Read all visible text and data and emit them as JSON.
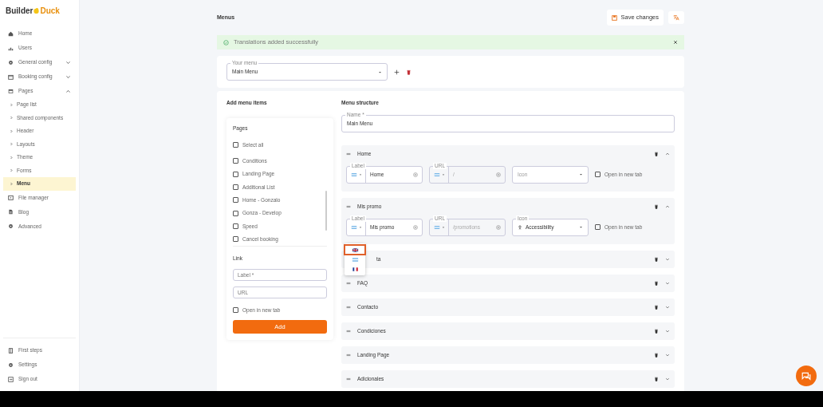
{
  "sidebar": {
    "logo": {
      "first": "Builder",
      "second": "Duck"
    },
    "items": [
      {
        "label": "Home"
      },
      {
        "label": "Users"
      },
      {
        "label": "General config",
        "expanded": false
      },
      {
        "label": "Booking config",
        "expanded": false
      },
      {
        "label": "Pages",
        "expanded": true,
        "children": [
          {
            "label": "Page list",
            "selected": false
          },
          {
            "label": "Shared components",
            "selected": false
          },
          {
            "label": "Header",
            "selected": false
          },
          {
            "label": "Layouts",
            "selected": false
          },
          {
            "label": "Theme",
            "selected": false
          },
          {
            "label": "Forms",
            "selected": false
          },
          {
            "label": "Menu",
            "selected": true
          }
        ]
      },
      {
        "label": "File manager"
      },
      {
        "label": "Blog"
      },
      {
        "label": "Advanced"
      }
    ],
    "bottom_items": [
      {
        "label": "First steps"
      },
      {
        "label": "Settings"
      },
      {
        "label": "Sign out"
      }
    ]
  },
  "header": {
    "title": "Menus",
    "save_button": "Save changes"
  },
  "alert": {
    "text": "Translations added successfully"
  },
  "menu_select": {
    "label": "Your menu",
    "value": "Main Menu"
  },
  "add_items": {
    "title": "Add menu items",
    "pages": {
      "title": "Pages",
      "select_all": {
        "label": "Select all",
        "checked": false
      },
      "items": [
        {
          "label": "Conditions",
          "checked": false
        },
        {
          "label": "Landing Page",
          "checked": false
        },
        {
          "label": "Additional List",
          "checked": false
        },
        {
          "label": "Home - Gonzalo",
          "checked": false
        },
        {
          "label": "Gonza - Develop",
          "checked": false
        },
        {
          "label": "Speed",
          "checked": false
        },
        {
          "label": "Cancel booking",
          "checked": false
        }
      ]
    },
    "link": {
      "title": "Link",
      "label_placeholder": "Label *",
      "url_placeholder": "URL",
      "new_tab": {
        "label": "Open in new tab",
        "checked": false
      },
      "button": "Add"
    }
  },
  "structure": {
    "title": "Menu structure",
    "name_field": {
      "label": "Name *",
      "value": "Main Menu"
    },
    "items": [
      {
        "label": "Home",
        "expanded": true,
        "label_field": {
          "label": "Label",
          "value": "Home"
        },
        "url_field": {
          "label": "URL",
          "value": "/",
          "disabled": true
        },
        "icon_field": {
          "placeholder": "Icon"
        },
        "new_tab": {
          "label": "Open in new tab",
          "checked": false
        }
      },
      {
        "label": "Mis promo",
        "expanded": true,
        "label_field": {
          "label": "Label",
          "value": "Mis promo"
        },
        "url_field": {
          "label": "URL",
          "value": "/promotions",
          "disabled": true
        },
        "icon_field": {
          "label": "Icon",
          "value": "Accessibility"
        },
        "new_tab": {
          "label": "Open in new tab",
          "checked": false
        }
      },
      {
        "label": "ta",
        "expanded": false
      },
      {
        "label": "FAQ",
        "expanded": false
      },
      {
        "label": "Contacto",
        "expanded": false
      },
      {
        "label": "Condiciones",
        "expanded": false
      },
      {
        "label": "Landing Page",
        "expanded": false
      },
      {
        "label": "Adicionales",
        "expanded": false
      }
    ]
  },
  "language_menu": {
    "options": [
      {
        "selected": true
      },
      {
        "selected": false
      },
      {
        "selected": false
      }
    ]
  }
}
